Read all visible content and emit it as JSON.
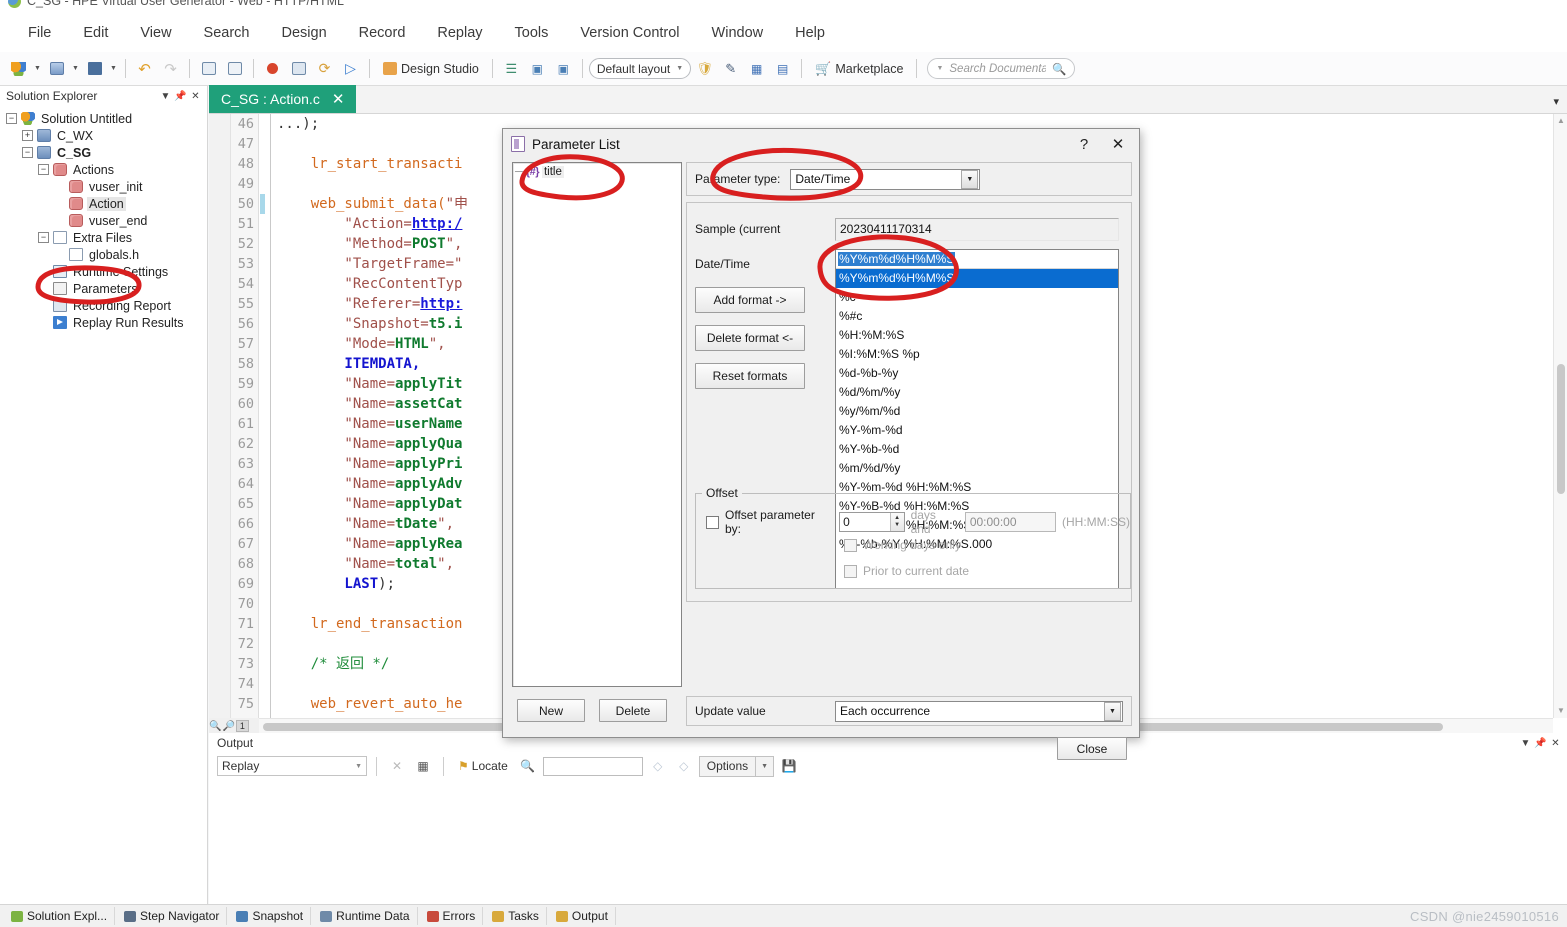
{
  "window": {
    "title": "C_SG - HPE Virtual User Generator - Web - HTTP/HTML"
  },
  "menu": {
    "items": [
      "File",
      "Edit",
      "View",
      "Search",
      "Design",
      "Record",
      "Replay",
      "Tools",
      "Version Control",
      "Window",
      "Help"
    ]
  },
  "toolbar": {
    "design_studio": "Design Studio",
    "layout": "Default layout",
    "marketplace": "Marketplace",
    "search_placeholder": "Search Documentat..."
  },
  "solution_explorer": {
    "title": "Solution Explorer",
    "nodes": [
      {
        "label": "Solution Untitled",
        "level": 0,
        "expander": "minus",
        "icon": "solution-icon",
        "bold": false,
        "selected": false
      },
      {
        "label": "C_WX",
        "level": 1,
        "expander": "plus",
        "icon": "vuser-icon",
        "bold": false,
        "selected": false
      },
      {
        "label": "C_SG",
        "level": 1,
        "expander": "minus",
        "icon": "vuser-icon",
        "bold": true,
        "selected": false
      },
      {
        "label": "Actions",
        "level": 2,
        "expander": "minus",
        "icon": "actions-icon",
        "bold": false,
        "selected": false
      },
      {
        "label": "vuser_init",
        "level": 3,
        "expander": "none",
        "icon": "action-icon",
        "bold": false,
        "selected": false
      },
      {
        "label": "Action",
        "level": 3,
        "expander": "none",
        "icon": "action-icon",
        "bold": false,
        "selected": true
      },
      {
        "label": "vuser_end",
        "level": 3,
        "expander": "none",
        "icon": "action-icon",
        "bold": false,
        "selected": false
      },
      {
        "label": "Extra Files",
        "level": 2,
        "expander": "minus",
        "icon": "file-icon",
        "bold": false,
        "selected": false
      },
      {
        "label": "globals.h",
        "level": 3,
        "expander": "none",
        "icon": "file-icon",
        "bold": false,
        "selected": false
      },
      {
        "label": "Runtime Settings",
        "level": 2,
        "expander": "none",
        "icon": "runtime-settings-icon",
        "bold": false,
        "selected": false
      },
      {
        "label": "Parameters",
        "level": 2,
        "expander": "none",
        "icon": "parameters-icon",
        "bold": false,
        "selected": false
      },
      {
        "label": "Recording Report",
        "level": 2,
        "expander": "none",
        "icon": "recording-report-icon",
        "bold": false,
        "selected": false
      },
      {
        "label": "Replay Run Results",
        "level": 2,
        "expander": "none",
        "icon": "replay-run-results-icon",
        "bold": false,
        "selected": false
      }
    ]
  },
  "editor": {
    "tab_label": "C_SG : Action.c",
    "zoom_level": "1",
    "first_line": 46,
    "lines": [
      {
        "n": 46,
        "tokens": [
          {
            "t": "...);",
            "c": "plain"
          }
        ]
      },
      {
        "n": 47,
        "tokens": []
      },
      {
        "n": 48,
        "tokens": [
          {
            "t": "    lr_start_transacti",
            "c": "fn"
          }
        ]
      },
      {
        "n": 49,
        "tokens": []
      },
      {
        "n": 50,
        "tokens": [
          {
            "t": "    web_submit_data(",
            "c": "fn"
          },
          {
            "t": "\"申",
            "c": "str"
          }
        ]
      },
      {
        "n": 51,
        "tokens": [
          {
            "t": "        \"Action=",
            "c": "str"
          },
          {
            "t": "http:/",
            "c": "link"
          }
        ]
      },
      {
        "n": 52,
        "tokens": [
          {
            "t": "        \"Method=",
            "c": "str"
          },
          {
            "t": "POST",
            "c": "val"
          },
          {
            "t": "\",",
            "c": "str"
          }
        ]
      },
      {
        "n": 53,
        "tokens": [
          {
            "t": "        \"TargetFrame=\"",
            "c": "str"
          }
        ]
      },
      {
        "n": 54,
        "tokens": [
          {
            "t": "        \"RecContentTyp",
            "c": "str"
          }
        ]
      },
      {
        "n": 55,
        "tokens": [
          {
            "t": "        \"Referer=",
            "c": "str"
          },
          {
            "t": "http:",
            "c": "link"
          }
        ]
      },
      {
        "n": 56,
        "tokens": [
          {
            "t": "        \"Snapshot=",
            "c": "str"
          },
          {
            "t": "t5.i",
            "c": "val"
          }
        ]
      },
      {
        "n": 57,
        "tokens": [
          {
            "t": "        \"Mode=",
            "c": "str"
          },
          {
            "t": "HTML",
            "c": "val"
          },
          {
            "t": "\",",
            "c": "str"
          }
        ]
      },
      {
        "n": 58,
        "tokens": [
          {
            "t": "        ITEMDATA,",
            "c": "kw"
          }
        ]
      },
      {
        "n": 59,
        "tokens": [
          {
            "t": "        \"Name=",
            "c": "str"
          },
          {
            "t": "applyTit",
            "c": "val"
          }
        ]
      },
      {
        "n": 60,
        "tokens": [
          {
            "t": "        \"Name=",
            "c": "str"
          },
          {
            "t": "assetCat",
            "c": "val"
          }
        ]
      },
      {
        "n": 61,
        "tokens": [
          {
            "t": "        \"Name=",
            "c": "str"
          },
          {
            "t": "userName",
            "c": "val"
          }
        ]
      },
      {
        "n": 62,
        "tokens": [
          {
            "t": "        \"Name=",
            "c": "str"
          },
          {
            "t": "applyQua",
            "c": "val"
          }
        ]
      },
      {
        "n": 63,
        "tokens": [
          {
            "t": "        \"Name=",
            "c": "str"
          },
          {
            "t": "applyPri",
            "c": "val"
          }
        ]
      },
      {
        "n": 64,
        "tokens": [
          {
            "t": "        \"Name=",
            "c": "str"
          },
          {
            "t": "applyAdv",
            "c": "val"
          }
        ]
      },
      {
        "n": 65,
        "tokens": [
          {
            "t": "        \"Name=",
            "c": "str"
          },
          {
            "t": "applyDat",
            "c": "val"
          }
        ]
      },
      {
        "n": 66,
        "tokens": [
          {
            "t": "        \"Name=",
            "c": "str"
          },
          {
            "t": "tDate",
            "c": "val"
          },
          {
            "t": "\",",
            "c": "str"
          }
        ]
      },
      {
        "n": 67,
        "tokens": [
          {
            "t": "        \"Name=",
            "c": "str"
          },
          {
            "t": "applyRea",
            "c": "val"
          }
        ]
      },
      {
        "n": 68,
        "tokens": [
          {
            "t": "        \"Name=",
            "c": "str"
          },
          {
            "t": "total",
            "c": "val"
          },
          {
            "t": "\",",
            "c": "str"
          }
        ]
      },
      {
        "n": 69,
        "tokens": [
          {
            "t": "        LAST",
            "c": "kw"
          },
          {
            "t": ");",
            "c": "plain"
          }
        ]
      },
      {
        "n": 70,
        "tokens": []
      },
      {
        "n": 71,
        "tokens": [
          {
            "t": "    lr_end_transaction",
            "c": "fn"
          }
        ]
      },
      {
        "n": 72,
        "tokens": []
      },
      {
        "n": 73,
        "tokens": [
          {
            "t": "    /* 返回 */",
            "c": "cmt"
          }
        ]
      },
      {
        "n": 74,
        "tokens": []
      },
      {
        "n": 75,
        "tokens": [
          {
            "t": "    web_revert_auto_he",
            "c": "fn"
          }
        ]
      }
    ]
  },
  "output": {
    "title": "Output",
    "source": "Replay",
    "locate_label": "Locate",
    "search_value": "",
    "options_label": "Options"
  },
  "statusbar": {
    "items": [
      {
        "label": "Solution Expl...",
        "icon": "solution-icon"
      },
      {
        "label": "Step Navigator",
        "icon": "pencil-icon"
      },
      {
        "label": "Snapshot",
        "icon": "snapshot-icon"
      },
      {
        "label": "Runtime Data",
        "icon": "runtime-data-icon"
      },
      {
        "label": "Errors",
        "icon": "errors-icon"
      },
      {
        "label": "Tasks",
        "icon": "tasks-icon"
      },
      {
        "label": "Output",
        "icon": "output-icon"
      }
    ],
    "watermark": "CSDN @nie2459010516"
  },
  "dialog": {
    "title": "Parameter List",
    "help_glyph": "?",
    "close_glyph": "✕",
    "tree": {
      "items": [
        {
          "icon_text": "{#}",
          "label": "title"
        }
      ]
    },
    "parameter_type_label": "Parameter type:",
    "parameter_type_value": "Date/Time",
    "sample_label": "Sample (current",
    "sample_value": "20230411170314",
    "datetime_label": "Date/Time",
    "format_edit_value": "%Y%m%d%H%M%S",
    "formats": [
      "%Y%m%d%H%M%S",
      "%c",
      "%#c",
      "%H:%M:%S",
      "%I:%M:%S %p",
      "%d-%b-%y",
      "%d/%m/%y",
      "%y/%m/%d",
      "%Y-%m-%d",
      "%Y-%b-%d",
      "%m/%d/%y",
      "%Y-%m-%d %H:%M:%S",
      "%Y-%B-%d %H:%M:%S",
      "%Y-%m-%d %H:%M:%S.000",
      "%d-%b-%Y %H:%M:%S.000"
    ],
    "selected_format_index": 0,
    "buttons": {
      "add_format": "Add format ->",
      "delete_format": "Delete format <-",
      "reset_formats": "Reset formats",
      "new": "New",
      "delete": "Delete",
      "close": "Close"
    },
    "offset": {
      "legend": "Offset",
      "checkbox_label": "Offset parameter by:",
      "checked": false,
      "days_value": "0",
      "days_label": "days and",
      "time_value": "00:00:00",
      "time_hint": "(HH:MM:SS)",
      "working_days_label": "Working days only",
      "working_days_checked": false,
      "prior_label": "Prior to current date",
      "prior_checked": false
    },
    "update_value_label": "Update value",
    "update_value": "Each occurrence"
  }
}
